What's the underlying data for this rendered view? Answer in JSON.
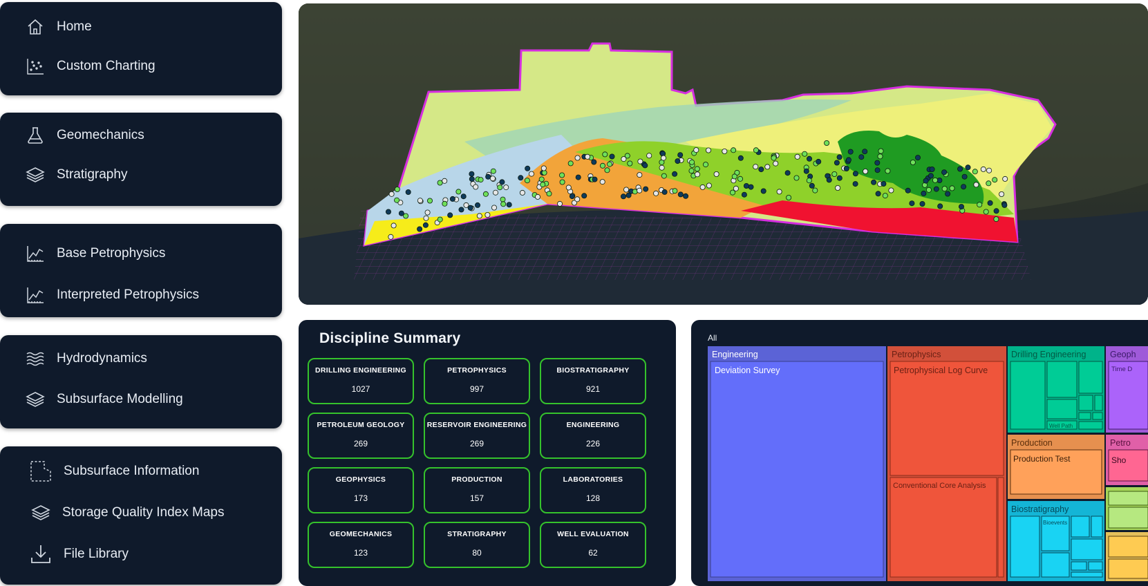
{
  "nav_groups": [
    {
      "items": [
        {
          "label": "Home",
          "icon": "home-icon"
        },
        {
          "label": "Custom Charting",
          "icon": "scatter-chart-icon"
        }
      ]
    },
    {
      "items": [
        {
          "label": "Geomechanics",
          "icon": "flask-icon"
        },
        {
          "label": "Stratigraphy",
          "icon": "layers-icon"
        }
      ]
    },
    {
      "items": [
        {
          "label": "Base Petrophysics",
          "icon": "line-chart-icon"
        },
        {
          "label": "Interpreted Petrophysics",
          "icon": "line-chart-icon"
        }
      ]
    },
    {
      "items": [
        {
          "label": "Hydrodynamics",
          "icon": "waves-icon"
        },
        {
          "label": "Subsurface Modelling",
          "icon": "layers-icon"
        }
      ]
    },
    {
      "items": [
        {
          "label": "Subsurface Information",
          "icon": "dashed-region-icon"
        },
        {
          "label": "Storage Quality Index Maps",
          "icon": "layers-icon"
        },
        {
          "label": "File Library",
          "icon": "download-icon"
        }
      ]
    }
  ],
  "discipline_summary": {
    "title": "Discipline Summary",
    "cards": [
      {
        "name": "DRILLING ENGINEERING",
        "value": "1027"
      },
      {
        "name": "PETROPHYSICS",
        "value": "997"
      },
      {
        "name": "BIOSTRATIGRAPHY",
        "value": "921"
      },
      {
        "name": "PETROLEUM GEOLOGY",
        "value": "269"
      },
      {
        "name": "RESERVOIR ENGINEERING",
        "value": "269"
      },
      {
        "name": "ENGINEERING",
        "value": "226"
      },
      {
        "name": "GEOPHYSICS",
        "value": "173"
      },
      {
        "name": "PRODUCTION",
        "value": "157"
      },
      {
        "name": "LABORATORIES",
        "value": "128"
      },
      {
        "name": "GEOMECHANICS",
        "value": "123"
      },
      {
        "name": "STRATIGRAPHY",
        "value": "80"
      },
      {
        "name": "WELL EVALUATION",
        "value": "62"
      }
    ],
    "accent_color": "#35c22c"
  },
  "treemap": {
    "root_label": "All",
    "groups": [
      {
        "label": "Engineering",
        "color": "#5b63d6",
        "children": [
          {
            "label": "Deviation Survey",
            "color": "#636efa"
          }
        ]
      },
      {
        "label": "Petrophysics",
        "color": "#d2503a",
        "children": [
          {
            "label": "Petrophysical Log Curve",
            "color": "#ef553b"
          },
          {
            "label": "Conventional Core Analysis",
            "color": "#ef553b"
          }
        ]
      },
      {
        "label": "Drilling Engineering",
        "color": "#00b38a",
        "children": [
          {
            "label": "Well Path",
            "color": "#00cc96"
          }
        ]
      },
      {
        "label": "Geoph",
        "color": "#9f5ad9",
        "children": [
          {
            "label": "Time D",
            "color": "#ab63fa"
          }
        ]
      },
      {
        "label": "Production",
        "color": "#e6904f",
        "children": [
          {
            "label": "Production Test",
            "color": "#ffa15a"
          }
        ]
      },
      {
        "label": "Petro",
        "color": "#e060a8",
        "children": [
          {
            "label": "Sho",
            "color": "#ff6692"
          }
        ]
      },
      {
        "label": "Biostratigraphy",
        "color": "#14b5d6",
        "children": [
          {
            "label": "Bioevents",
            "color": "#19d3f3"
          }
        ]
      }
    ]
  }
}
